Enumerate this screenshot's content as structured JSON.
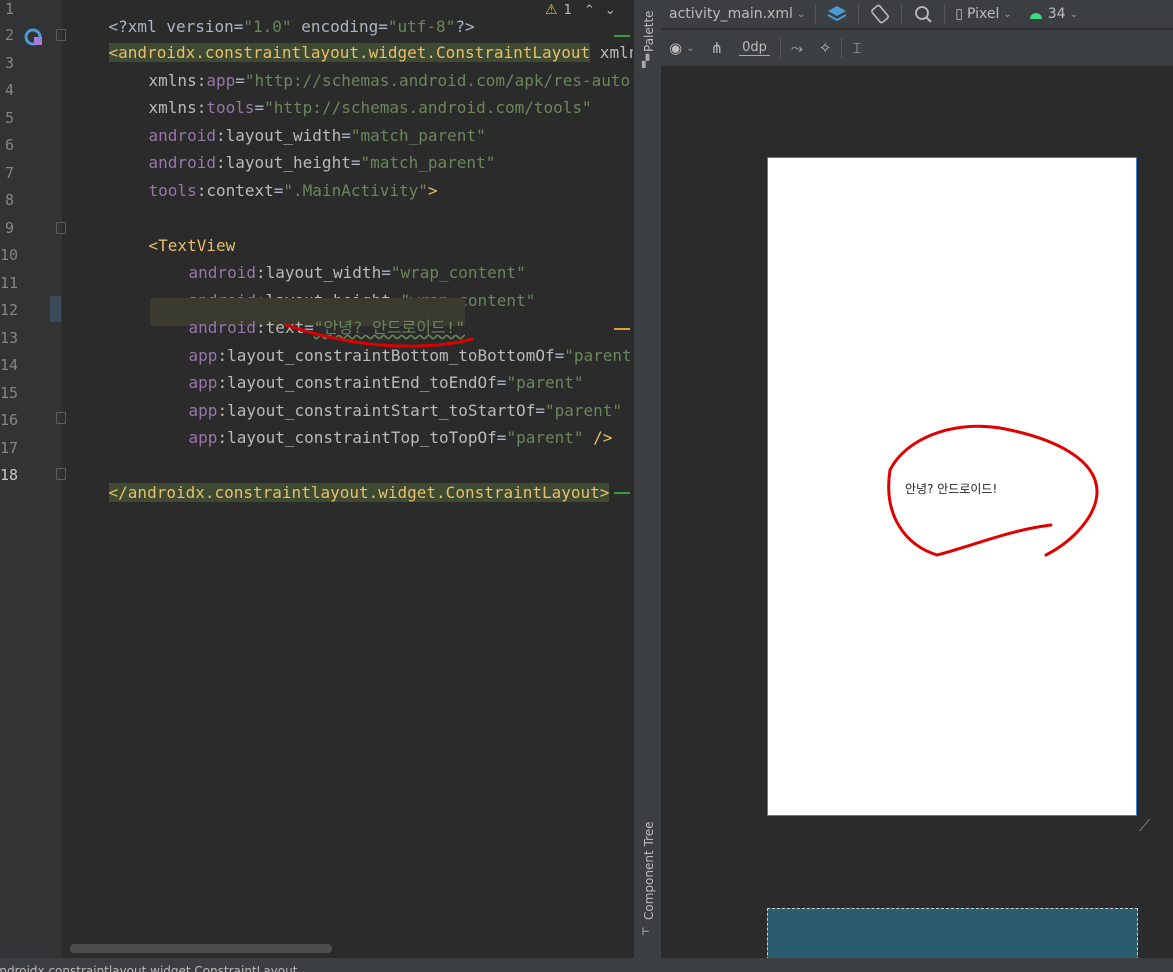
{
  "editor": {
    "warning_count": "1",
    "lines": [
      {
        "n": "1"
      },
      {
        "n": "2"
      },
      {
        "n": "3"
      },
      {
        "n": "4"
      },
      {
        "n": "5"
      },
      {
        "n": "6"
      },
      {
        "n": "7"
      },
      {
        "n": "8"
      },
      {
        "n": "9"
      },
      {
        "n": "10"
      },
      {
        "n": "11"
      },
      {
        "n": "12"
      },
      {
        "n": "13"
      },
      {
        "n": "14"
      },
      {
        "n": "15"
      },
      {
        "n": "16"
      },
      {
        "n": "17"
      },
      {
        "n": "18"
      }
    ],
    "code": {
      "l1_a": "<?xml version=",
      "l1_b": "\"1.0\"",
      "l1_c": " encoding=",
      "l1_d": "\"utf-8\"",
      "l1_e": "?>",
      "l2_tag": "<androidx.constraintlayout.widget.ConstraintLayout",
      "l2_attr": " xmlns",
      "l3_ns": "xmlns:",
      "l3_a": "app",
      "l3_eq": "=",
      "l3_v": "\"http://schemas.android.com/apk/res-auto\"",
      "l4_ns": "xmlns:",
      "l4_a": "tools",
      "l4_eq": "=",
      "l4_v": "\"http://schemas.android.com/tools\"",
      "l5_ns": "android",
      "l5_a": ":layout_width",
      "l5_eq": "=",
      "l5_v": "\"match_parent\"",
      "l6_ns": "android",
      "l6_a": ":layout_height",
      "l6_eq": "=",
      "l6_v": "\"match_parent\"",
      "l7_ns": "tools",
      "l7_a": ":context",
      "l7_eq": "=",
      "l7_v": "\".MainActivity\"",
      "l7_e": ">",
      "l9_tag": "<TextView",
      "l10_ns": "android",
      "l10_a": ":layout_width",
      "l10_eq": "=",
      "l10_v": "\"wrap_content\"",
      "l11_ns": "android",
      "l11_a": ":layout_height",
      "l11_eq": "=",
      "l11_v": "\"wrap_content\"",
      "l12_ns": "android",
      "l12_a": ":text",
      "l12_eq": "=",
      "l12_v": "\"안녕? 안드로이드!\"",
      "l13_ns": "app",
      "l13_a": ":layout_constraintBottom_toBottomOf",
      "l13_eq": "=",
      "l13_v": "\"parent\"",
      "l14_ns": "app",
      "l14_a": ":layout_constraintEnd_toEndOf",
      "l14_eq": "=",
      "l14_v": "\"parent\"",
      "l15_ns": "app",
      "l15_a": ":layout_constraintStart_toStartOf",
      "l15_eq": "=",
      "l15_v": "\"parent\"",
      "l16_ns": "app",
      "l16_a": ":layout_constraintTop_toTopOf",
      "l16_eq": "=",
      "l16_v": "\"parent\"",
      "l16_e": " />",
      "l18_tag": "</androidx.constraintlayout.widget.ConstraintLayout>"
    }
  },
  "side_panel": {
    "palette_label": "Palette",
    "component_tree_label": "Component Tree"
  },
  "design": {
    "file_tab": "activity_main.xml",
    "device": "Pixel",
    "api_level": "34",
    "margin_value": "0dp",
    "preview_text": "안녕? 안드로이드!"
  },
  "status_bar": {
    "breadcrumb": "androidx.constraintlayout.widget.ConstraintLayout"
  },
  "colors": {
    "annotation_red": "#e00000",
    "accent_blue": "#3a7bd5"
  }
}
